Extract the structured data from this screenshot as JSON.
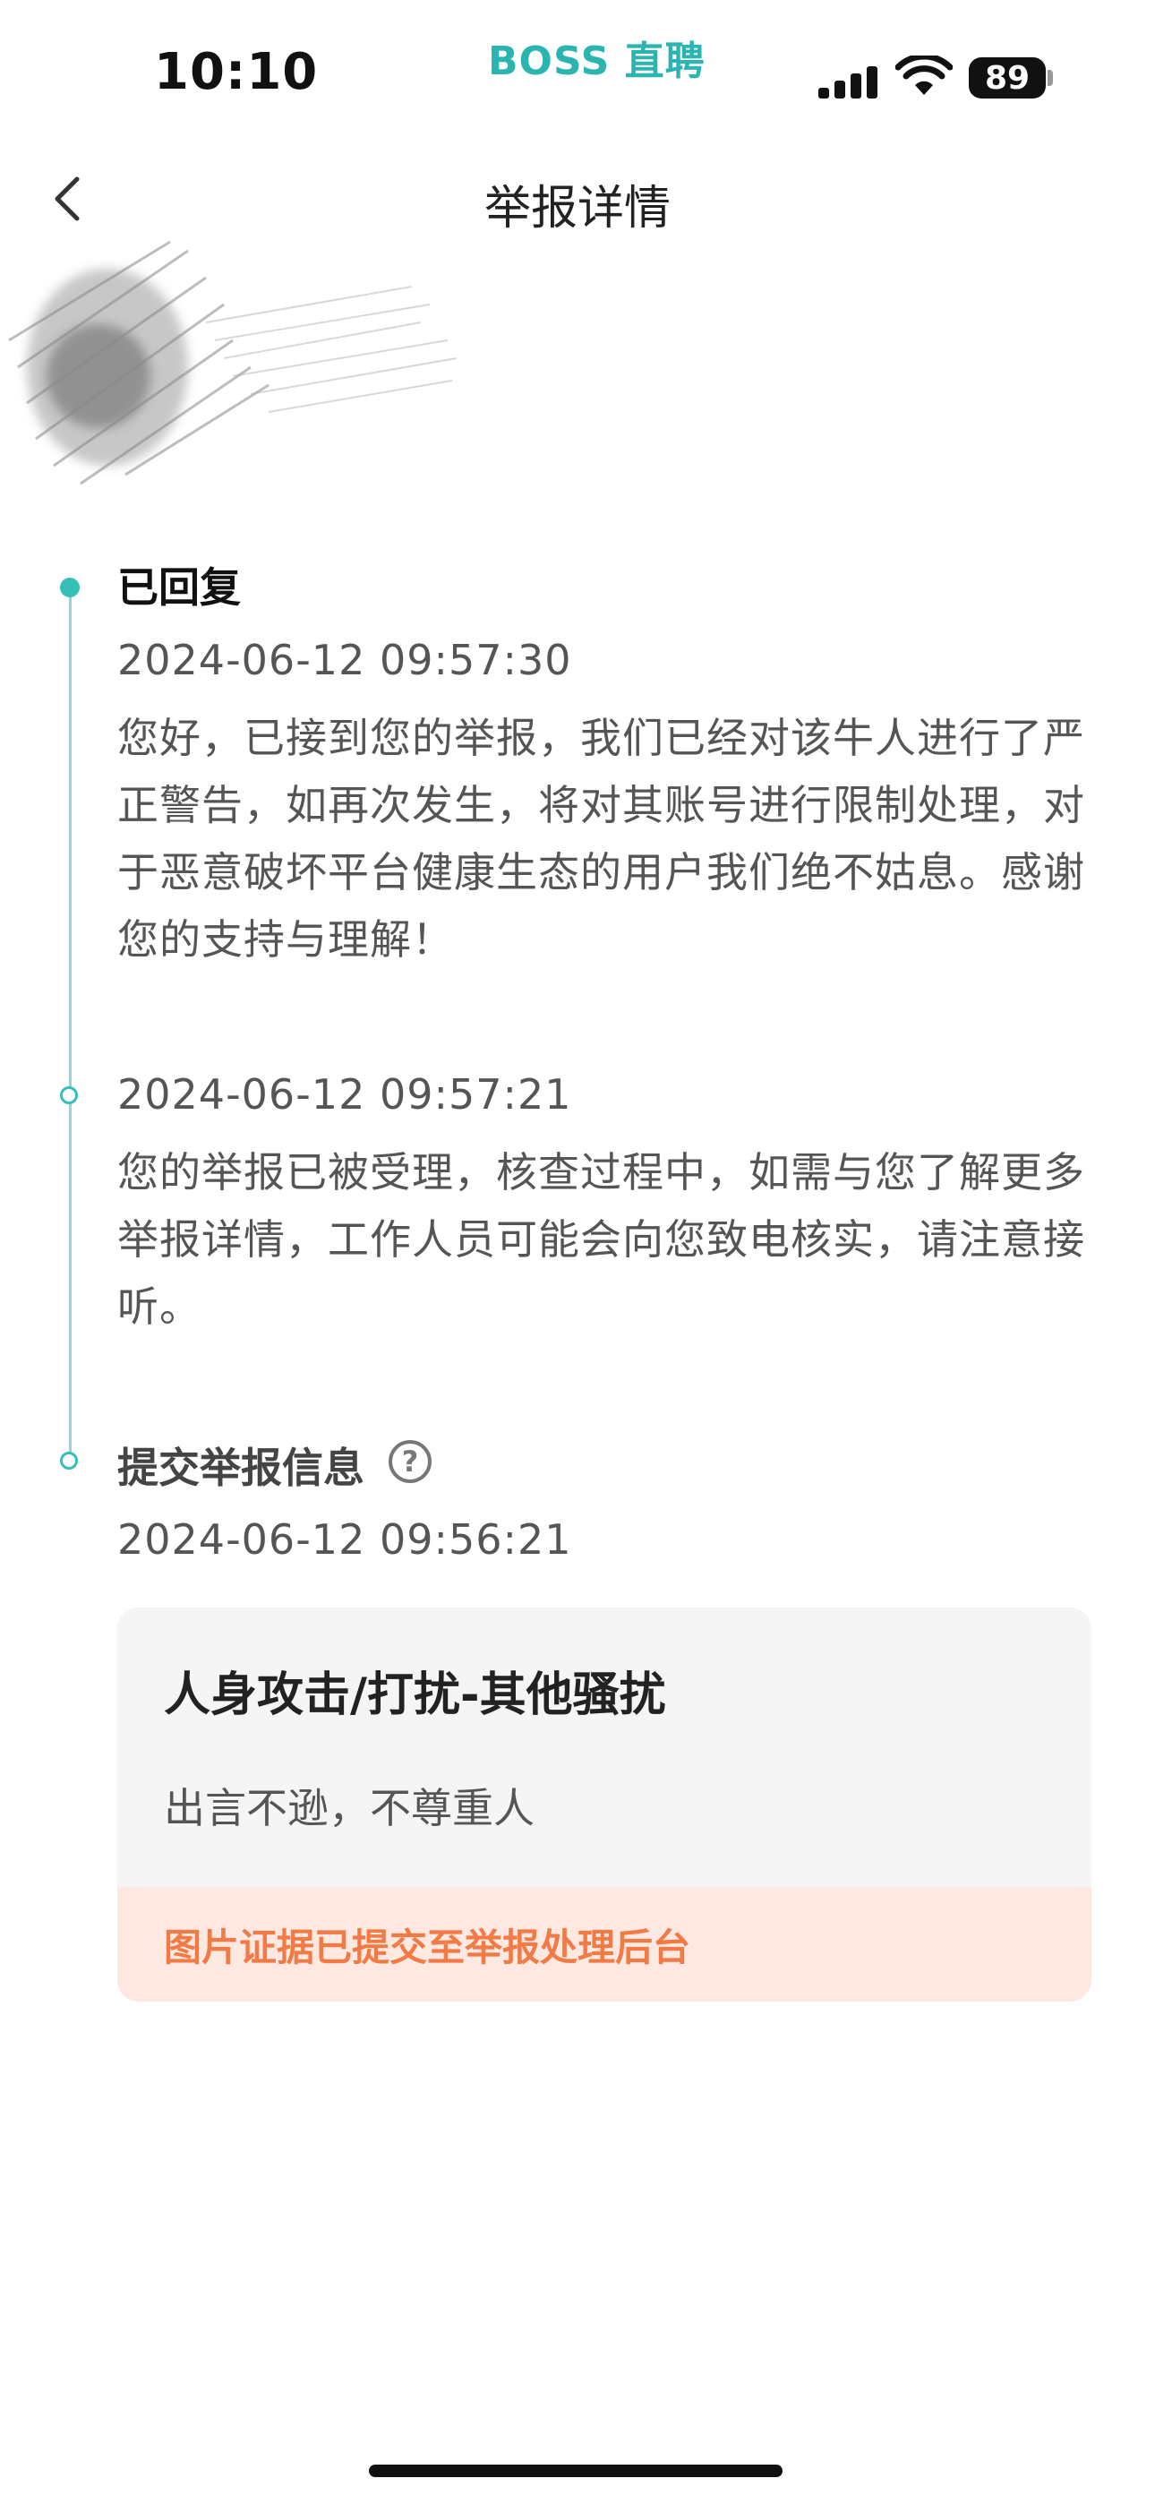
{
  "status_bar": {
    "time": "10:10",
    "brand": "BOSS 直聘",
    "battery": "89"
  },
  "nav": {
    "title": "举报详情",
    "back_icon": "chevron-left-icon"
  },
  "timeline": [
    {
      "heading": "已回复",
      "time": "2024-06-12 09:57:30",
      "body": "您好，已接到您的举报，我们已经对该牛人进行了严正警告，如再次发生，将对其账号进行限制处理，对于恶意破坏平台健康生态的用户我们绝不姑息。感谢您的支持与理解！"
    },
    {
      "time": "2024-06-12 09:57:21",
      "body": "您的举报已被受理，核查过程中，如需与您了解更多举报详情，工作人员可能会向您致电核实，请注意接听。"
    },
    {
      "heading": "提交举报信息",
      "time": "2024-06-12 09:56:21",
      "help_icon": "?"
    }
  ],
  "report_card": {
    "title": "人身攻击/打扰-其他骚扰",
    "description": "出言不逊，不尊重人",
    "footer": "图片证据已提交至举报处理后台"
  },
  "colors": {
    "brand": "#2bb5b1",
    "timeline": "#35bfb8",
    "footer_bg": "#fde9e1",
    "footer_text": "#f17a45"
  }
}
